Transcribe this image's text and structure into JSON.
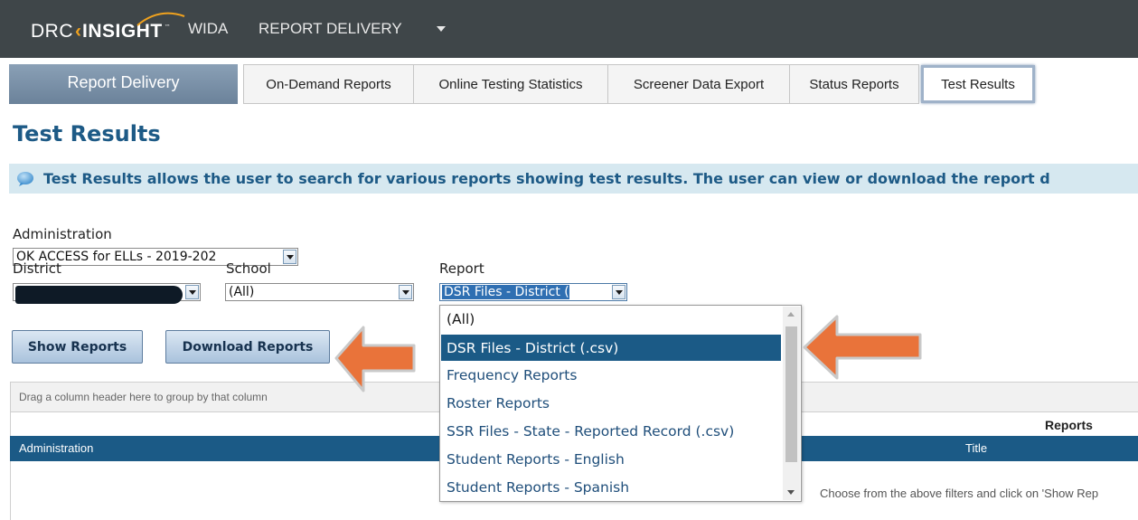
{
  "header": {
    "logo": {
      "left": "DRC",
      "right": "INSIGHT",
      "trademark": "™"
    },
    "product": "WIDA",
    "menu": "REPORT DELIVERY"
  },
  "nav": {
    "title": "Report Delivery",
    "tabs": [
      {
        "label": "On-Demand Reports"
      },
      {
        "label": "Online Testing Statistics"
      },
      {
        "label": "Screener Data Export"
      },
      {
        "label": "Status Reports"
      },
      {
        "label": "Test Results",
        "active": true
      }
    ]
  },
  "page": {
    "title": "Test Results",
    "info": "Test Results allows the user to search for various reports showing test results. The user can view or download the report d"
  },
  "filters": {
    "administration": {
      "label": "Administration",
      "value": "OK ACCESS for ELLs - 2019-202"
    },
    "district": {
      "label": "District",
      "value": ""
    },
    "school": {
      "label": "School",
      "value": "(All)"
    },
    "report": {
      "label": "Report",
      "value": "DSR Files - District (",
      "options": [
        "(All)",
        "DSR Files - District (.csv)",
        "Frequency Reports",
        "Roster Reports",
        "SSR Files - State - Reported Record (.csv)",
        "Student Reports - English",
        "Student Reports - Spanish"
      ],
      "selected_index": 1
    }
  },
  "buttons": {
    "show": "Show Reports",
    "download": "Download Reports"
  },
  "grid": {
    "group_hint": "Drag a column header here to group by that column",
    "group_header": "Reports",
    "columns": [
      "Administration",
      "Title"
    ],
    "empty_message": "Choose from the above filters and click on 'Show Rep"
  },
  "colors": {
    "topbar": "#3f4649",
    "accent_orange": "#e9733a",
    "title_blue": "#1d5a86",
    "grid_header": "#1b5a86",
    "info_bar": "#d6e8f0"
  }
}
